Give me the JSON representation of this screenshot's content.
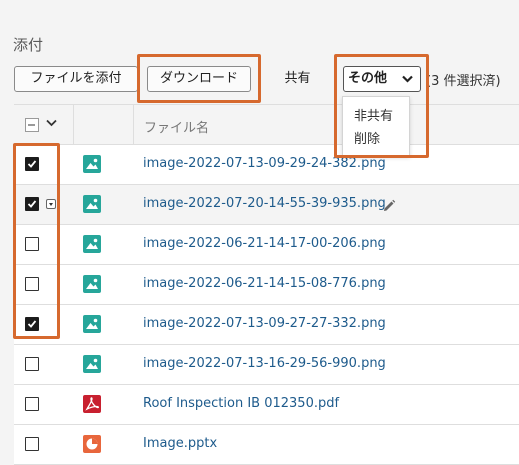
{
  "section": {
    "title": "添付"
  },
  "toolbar": {
    "attach_label": "ファイルを添付",
    "download_label": "ダウンロード",
    "share_label": "共有",
    "other_label": "その他",
    "selection_count": "(3 件選択済)"
  },
  "dropdown": {
    "items": [
      "非共有",
      "削除"
    ]
  },
  "table": {
    "header": {
      "name_label": "ファイル名"
    },
    "rows": [
      {
        "name": "image-2022-07-13-09-29-24-382.png",
        "checked": true,
        "icon": "image-icon",
        "color": "#26a69a"
      },
      {
        "name": "image-2022-07-20-14-55-39-935.png",
        "checked": true,
        "icon": "image-icon",
        "color": "#26a69a"
      },
      {
        "name": "image-2022-06-21-14-17-00-206.png",
        "checked": false,
        "icon": "image-icon",
        "color": "#26a69a"
      },
      {
        "name": "image-2022-06-21-14-15-08-776.png",
        "checked": false,
        "icon": "image-icon",
        "color": "#26a69a"
      },
      {
        "name": "image-2022-07-13-09-27-27-332.png",
        "checked": true,
        "icon": "image-icon",
        "color": "#26a69a"
      },
      {
        "name": "image-2022-07-13-16-29-56-990.png",
        "checked": false,
        "icon": "image-icon",
        "color": "#26a69a"
      },
      {
        "name": "Roof Inspection IB 012350.pdf",
        "checked": false,
        "icon": "pdf-icon",
        "color": "#c8202f"
      },
      {
        "name": "Image.pptx",
        "checked": false,
        "icon": "pptx-icon",
        "color": "#e8663c"
      }
    ]
  },
  "colors": {
    "highlight": "#d6692e",
    "link": "#1e5b8c"
  }
}
